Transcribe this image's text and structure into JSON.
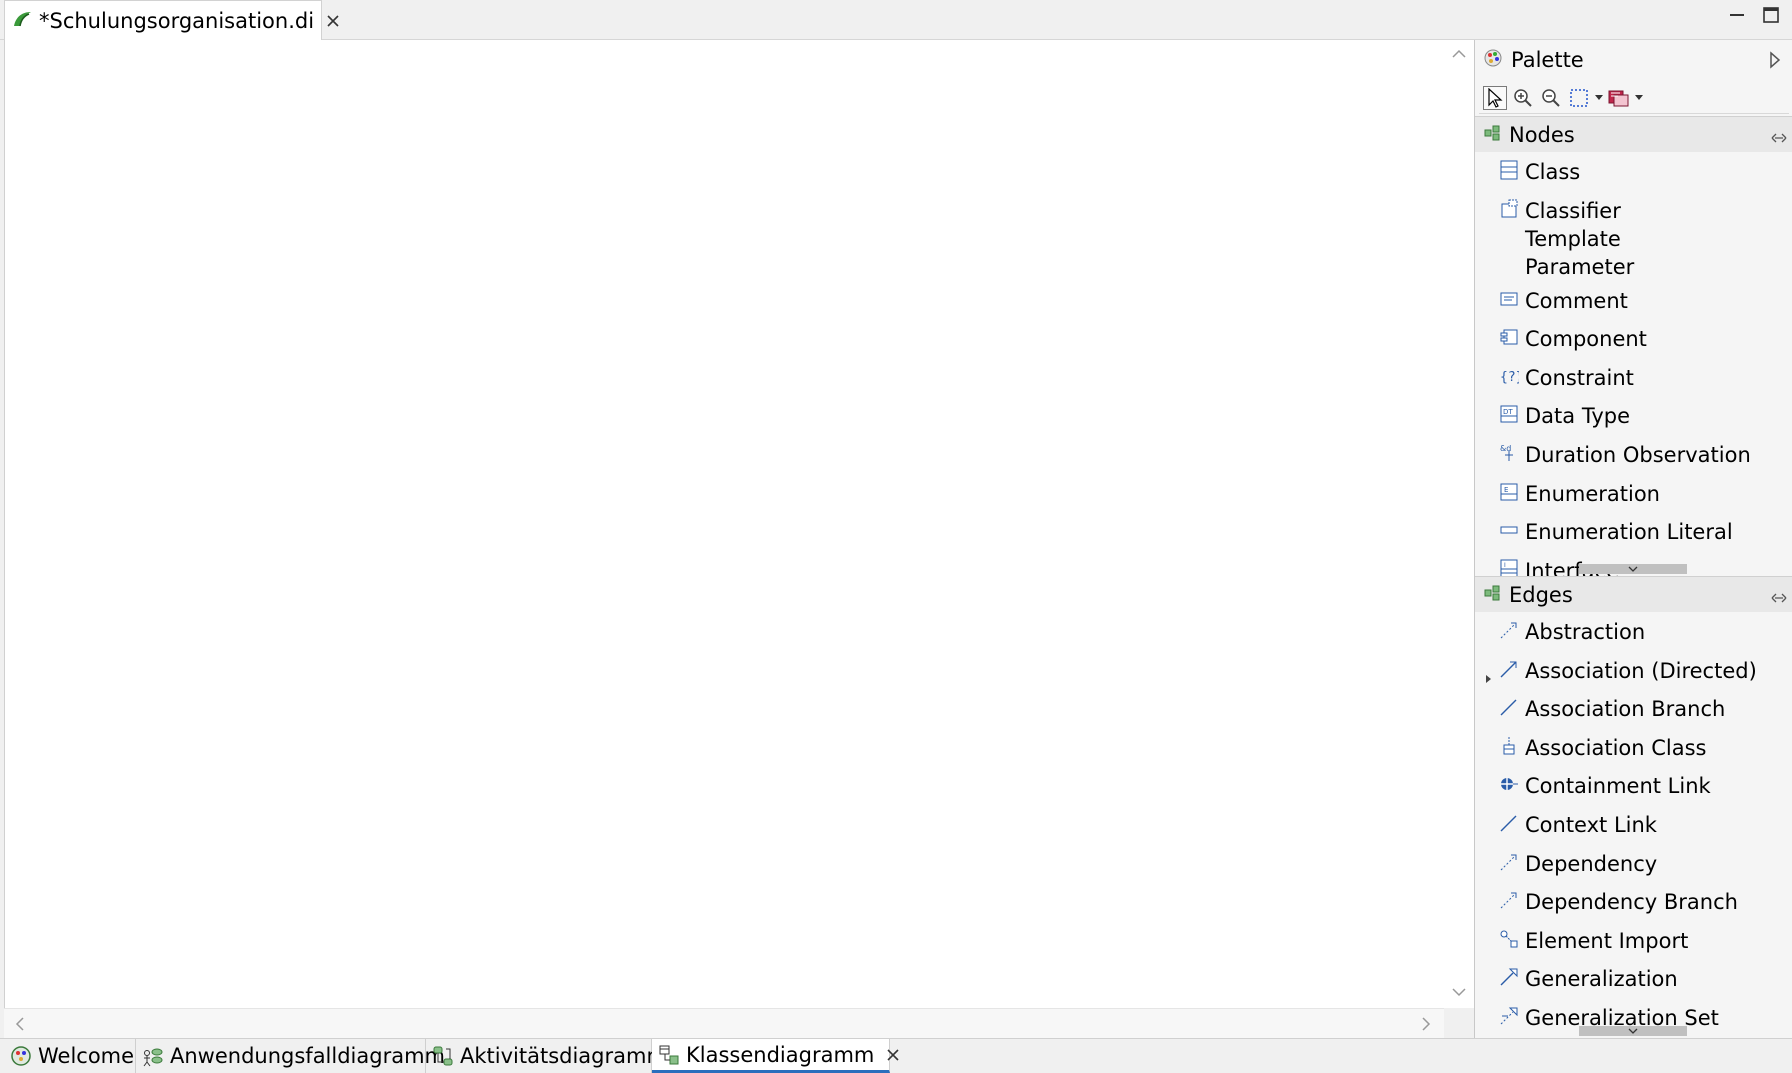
{
  "editor": {
    "tab_title": "*Schulungsorganisation.di",
    "tab_icon": "papyrus-icon"
  },
  "palette": {
    "title": "Palette",
    "tools": [
      "select-icon",
      "zoom-in-icon",
      "zoom-out-icon",
      "marquee-icon",
      "layer-tool-icon"
    ],
    "nodes": {
      "title": "Nodes",
      "items": [
        {
          "label": "Class",
          "icon": "class-icon"
        },
        {
          "label": "Classifier Template Parameter",
          "icon": "template-parameter-icon"
        },
        {
          "label": "Comment",
          "icon": "comment-icon"
        },
        {
          "label": "Component",
          "icon": "component-icon"
        },
        {
          "label": "Constraint",
          "icon": "constraint-icon"
        },
        {
          "label": "Data Type",
          "icon": "data-type-icon"
        },
        {
          "label": "Duration Observation",
          "icon": "duration-observation-icon"
        },
        {
          "label": "Enumeration",
          "icon": "enumeration-icon"
        },
        {
          "label": "Enumeration Literal",
          "icon": "enumeration-literal-icon"
        },
        {
          "label": "Interface",
          "icon": "interface-icon"
        }
      ]
    },
    "edges": {
      "title": "Edges",
      "items": [
        {
          "label": "Abstraction",
          "icon": "abstraction-icon"
        },
        {
          "label": "Association (Directed)",
          "icon": "association-directed-icon"
        },
        {
          "label": "Association Branch",
          "icon": "association-branch-icon"
        },
        {
          "label": "Association Class",
          "icon": "association-class-icon"
        },
        {
          "label": "Containment Link",
          "icon": "containment-link-icon"
        },
        {
          "label": "Context Link",
          "icon": "context-link-icon"
        },
        {
          "label": "Dependency",
          "icon": "dependency-icon"
        },
        {
          "label": "Dependency Branch",
          "icon": "dependency-branch-icon"
        },
        {
          "label": "Element Import",
          "icon": "element-import-icon"
        },
        {
          "label": "Generalization",
          "icon": "generalization-icon"
        },
        {
          "label": "Generalization Set",
          "icon": "generalization-set-icon"
        }
      ]
    }
  },
  "bottom_tabs": [
    {
      "label": "Welcome",
      "icon": "welcome-icon"
    },
    {
      "label": "Anwendungsfalldiagramm",
      "icon": "use-case-diagram-icon"
    },
    {
      "label": "Aktivitätsdiagramm",
      "icon": "activity-diagram-icon"
    },
    {
      "label": "Klassendiagramm",
      "icon": "class-diagram-icon"
    }
  ],
  "colors": {
    "active_tab_underline": "#2a6ebd",
    "canvas": "#ffffff",
    "chrome": "#f0f0f0"
  }
}
